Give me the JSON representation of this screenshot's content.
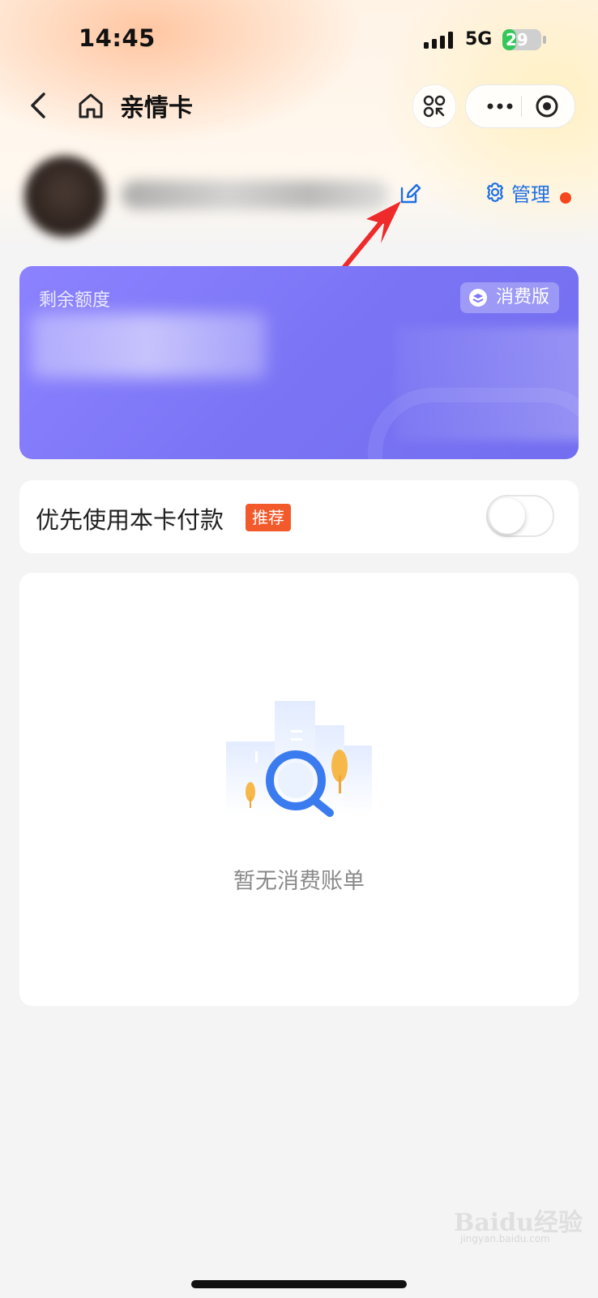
{
  "status_bar": {
    "time": "14:45",
    "network": "5G",
    "battery_percent": "29",
    "battery_level": 0.29
  },
  "nav": {
    "title": "亲情卡"
  },
  "profile": {
    "manage_label": "管理"
  },
  "quota_card": {
    "label": "剩余额度",
    "version_badge": "消费版",
    "background_color": "#7b75f5"
  },
  "pay_preference": {
    "label": "优先使用本卡付款",
    "tag": "推荐",
    "enabled": false
  },
  "bills": {
    "empty_text": "暂无消费账单"
  },
  "watermark": {
    "text": "Baidu经验",
    "sub": "jingyan.baidu.com"
  },
  "colors": {
    "accent_blue": "#1f6fe5",
    "tag_orange": "#f25a2b",
    "notify_red": "#f5471d"
  }
}
